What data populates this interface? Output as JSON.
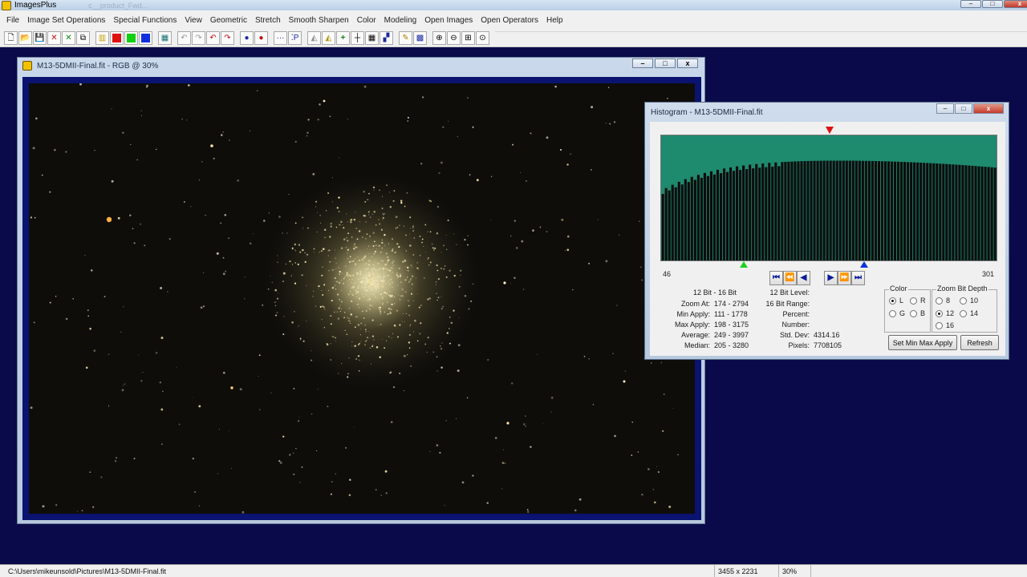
{
  "app": {
    "title": "ImagesPlus",
    "faint_title": "c__product_Fwd...",
    "ctl_min": "–",
    "ctl_max": "□",
    "ctl_close": "x"
  },
  "menu": [
    "File",
    "Image Set Operations",
    "Special Functions",
    "View",
    "Geometric",
    "Stretch",
    "Smooth Sharpen",
    "Color",
    "Modeling",
    "Open Images",
    "Open Operators",
    "Help"
  ],
  "toolbar": {
    "icons": {
      "new": "🗋",
      "open": "📂",
      "save": "💾",
      "close_red": "✕",
      "close_green": "✕",
      "copy": "⧉",
      "rgb": "▥",
      "mono": "▦",
      "undo": "↶",
      "redo": "↷",
      "undo_red": "↶",
      "redo_red": "↷",
      "circle_blue": "●",
      "circle_red": "●",
      "dots": "···",
      "dotsp": "⁚P",
      "tri": "◭",
      "tri2": "◭",
      "cross": "+",
      "cross2": "┼",
      "grid": "▦",
      "chart": "▞",
      "pencil": "✎",
      "grid2": "▩",
      "zoom_in": "⊕",
      "zoom_out": "⊖",
      "zoom_fit": "⊞",
      "zoom_100": "⊙"
    },
    "colors": {
      "red": "#e01010",
      "green": "#10d010",
      "blue": "#1030e0"
    }
  },
  "image_window": {
    "title": "M13-5DMII-Final.fit - RGB @ 30%",
    "min": "–",
    "max": "□",
    "close": "x"
  },
  "histogram": {
    "title": "Histogram - M13-5DMII-Final.fit",
    "min_label": "46",
    "max_label": "301",
    "nav": {
      "first": "⏮",
      "rew": "⏪",
      "prev": "◀",
      "next": "▶",
      "ff": "⏩",
      "last": "⏭"
    },
    "stats_left": {
      "header": "12 Bit - 16 Bit",
      "zoom_at_label": "Zoom At:",
      "zoom_at_value": "174 - 2794",
      "min_apply_label": "Min Apply:",
      "min_apply_value": "111 - 1778",
      "max_apply_label": "Max Apply:",
      "max_apply_value": "198 - 3175",
      "average_label": "Average:",
      "average_value": "249 - 3997",
      "median_label": "Median:",
      "median_value": "205 - 3280"
    },
    "stats_mid": {
      "level12_label": "12 Bit Level:",
      "range16_label": "16 Bit Range:",
      "percent_label": "Percent:",
      "number_label": "Number:",
      "stddev_label": "Std. Dev:",
      "stddev_value": "4314.16",
      "pixels_label": "Pixels:",
      "pixels_value": "7708105"
    },
    "color_group": {
      "title": "Color",
      "L": "L",
      "R": "R",
      "G": "G",
      "B": "B",
      "selected": "L"
    },
    "zoom_group": {
      "title": "Zoom Bit Depth",
      "o8": "8",
      "o10": "10",
      "o12": "12",
      "o14": "14",
      "o16": "16",
      "selected": "12"
    },
    "buttons": {
      "set_min_max": "Set Min Max Apply",
      "refresh": "Refresh"
    },
    "colors": {
      "plot_fill": "#1e8a6e",
      "plot_bg": "#0c0c0c"
    }
  },
  "status": {
    "path": "C:\\Users\\mikeunsold\\Pictures\\M13-5DMII-Final.fit",
    "dimensions": "3455 x 2231",
    "zoom": "30%"
  }
}
